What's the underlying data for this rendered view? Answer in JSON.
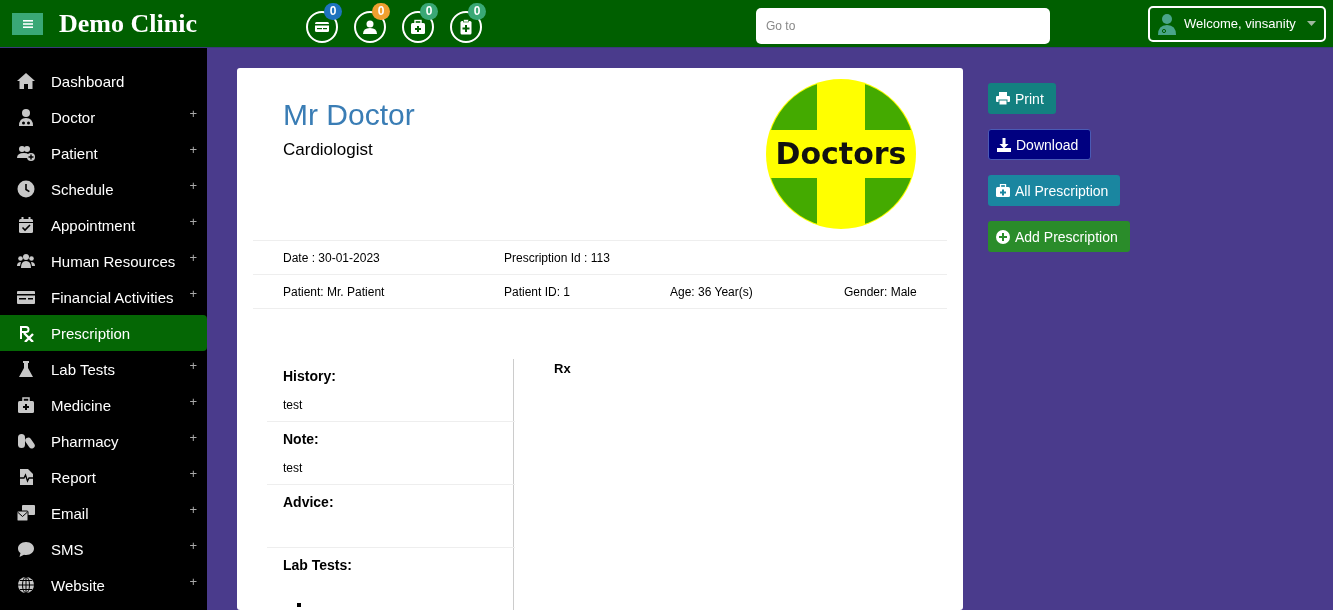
{
  "header": {
    "title": "Demo Clinic",
    "badges": [
      {
        "count": "0",
        "color": "#1e73be"
      },
      {
        "count": "0",
        "color": "#f0a030"
      },
      {
        "count": "0",
        "color": "#3aa876"
      },
      {
        "count": "0",
        "color": "#3aa876"
      }
    ],
    "search": {
      "placeholder": "Go to"
    },
    "user": {
      "label": "Welcome, vinsanity"
    }
  },
  "sidebar": {
    "items": [
      {
        "label": "Dashboard",
        "selected": false
      },
      {
        "label": "Doctor",
        "expander": "+",
        "selected": false
      },
      {
        "label": "Patient",
        "expander": "+",
        "selected": false
      },
      {
        "label": "Schedule",
        "expander": "+",
        "selected": false
      },
      {
        "label": "Appointment",
        "expander": "+",
        "selected": false
      },
      {
        "label": "Human Resources",
        "expander": "+",
        "selected": false
      },
      {
        "label": "Financial Activities",
        "expander": "+",
        "selected": false
      },
      {
        "label": "Prescription",
        "selected": true
      },
      {
        "label": "Lab Tests",
        "expander": "+",
        "selected": false
      },
      {
        "label": "Medicine",
        "expander": "+",
        "selected": false
      },
      {
        "label": "Pharmacy",
        "expander": "+",
        "selected": false
      },
      {
        "label": "Report",
        "expander": "+",
        "selected": false
      },
      {
        "label": "Email",
        "expander": "+",
        "selected": false
      },
      {
        "label": "SMS",
        "expander": "+",
        "selected": false
      },
      {
        "label": "Website",
        "expander": "+",
        "selected": false
      }
    ]
  },
  "prescription": {
    "doctor_name": "Mr Doctor",
    "specialty": "Cardiologist",
    "logo_text": "Doctors",
    "info_rows": [
      [
        "Date : 30-01-2023",
        "Prescription Id : 113"
      ],
      [
        "Patient: Mr. Patient",
        "Patient ID: 1",
        "Age: 36 Year(s)",
        "Gender: Male"
      ]
    ],
    "sections": [
      {
        "heading": "History:",
        "text": "test"
      },
      {
        "heading": "Note:",
        "text": "test"
      },
      {
        "heading": "Advice:"
      },
      {
        "heading": "Lab Tests:"
      }
    ],
    "rx_heading": "Rx"
  },
  "actions": [
    {
      "label": "Print",
      "kind": "print"
    },
    {
      "label": "Download",
      "kind": "download"
    },
    {
      "label": "All Prescription",
      "kind": "all"
    },
    {
      "label": "Add Prescription",
      "kind": "add"
    }
  ]
}
